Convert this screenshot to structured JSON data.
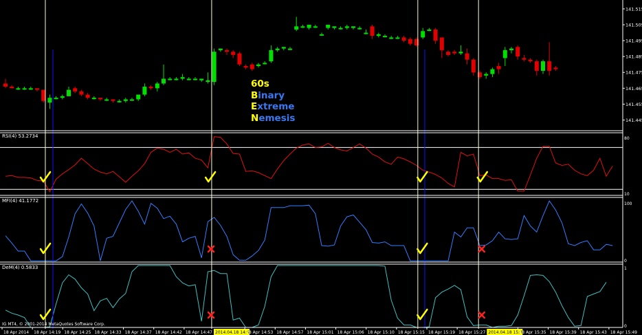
{
  "overlay": {
    "line1": "60s",
    "line2_first": "B",
    "line2_rest": "inary",
    "line3_first": "E",
    "line3_rest": "xtreme",
    "line4_first": "N",
    "line4_rest": "emesis"
  },
  "colors": {
    "background": "#000000",
    "up_candle": "#00e000",
    "down_candle": "#e00000",
    "rsi_line": "#e01010",
    "mfi_line": "#2f7fff",
    "dem_line": "#40c0c0",
    "separator": "#ffffff",
    "vline_marker": "#ffffcc",
    "vline_blue": "#1010ff",
    "check": "#ffff00",
    "cross": "#ff2020",
    "axis_text": "#ffffff",
    "highlight_label": "#ffff00"
  },
  "price_axis": {
    "labels": [
      "141.515",
      "141.505",
      "141.495",
      "141.485",
      "141.475",
      "141.465",
      "141.455",
      "141.445"
    ],
    "values": [
      141.515,
      141.505,
      141.495,
      141.485,
      141.475,
      141.465,
      141.455,
      141.445
    ]
  },
  "main_chart": {
    "type": "candlestick",
    "candles": [
      {
        "o": 141.468,
        "h": 141.471,
        "l": 141.465,
        "c": 141.466
      },
      {
        "o": 141.466,
        "h": 141.467,
        "l": 141.465,
        "c": 141.465
      },
      {
        "o": 141.465,
        "h": 141.466,
        "l": 141.464,
        "c": 141.465
      },
      {
        "o": 141.465,
        "h": 141.466,
        "l": 141.464,
        "c": 141.465
      },
      {
        "o": 141.465,
        "h": 141.466,
        "l": 141.464,
        "c": 141.465
      },
      {
        "o": 141.465,
        "h": 141.465,
        "l": 141.463,
        "c": 141.464
      },
      {
        "o": 141.464,
        "h": 141.464,
        "l": 141.456,
        "c": 141.457
      },
      {
        "o": 141.456,
        "h": 141.461,
        "l": 141.452,
        "c": 141.459
      },
      {
        "o": 141.459,
        "h": 141.46,
        "l": 141.458,
        "c": 141.459
      },
      {
        "o": 141.459,
        "h": 141.461,
        "l": 141.458,
        "c": 141.46
      },
      {
        "o": 141.46,
        "h": 141.466,
        "l": 141.46,
        "c": 141.464
      },
      {
        "o": 141.465,
        "h": 141.466,
        "l": 141.462,
        "c": 141.463
      },
      {
        "o": 141.463,
        "h": 141.464,
        "l": 141.46,
        "c": 141.461
      },
      {
        "o": 141.461,
        "h": 141.462,
        "l": 141.458,
        "c": 141.459
      },
      {
        "o": 141.459,
        "h": 141.46,
        "l": 141.458,
        "c": 141.459
      },
      {
        "o": 141.459,
        "h": 141.459,
        "l": 141.457,
        "c": 141.458
      },
      {
        "o": 141.458,
        "h": 141.459,
        "l": 141.457,
        "c": 141.458
      },
      {
        "o": 141.458,
        "h": 141.458,
        "l": 141.456,
        "c": 141.457
      },
      {
        "o": 141.457,
        "h": 141.458,
        "l": 141.456,
        "c": 141.457
      },
      {
        "o": 141.457,
        "h": 141.459,
        "l": 141.456,
        "c": 141.458
      },
      {
        "o": 141.458,
        "h": 141.459,
        "l": 141.457,
        "c": 141.458
      },
      {
        "o": 141.458,
        "h": 141.461,
        "l": 141.457,
        "c": 141.461
      },
      {
        "o": 141.461,
        "h": 141.468,
        "l": 141.46,
        "c": 141.466
      },
      {
        "o": 141.466,
        "h": 141.467,
        "l": 141.464,
        "c": 141.465
      },
      {
        "o": 141.465,
        "h": 141.469,
        "l": 141.463,
        "c": 141.468
      },
      {
        "o": 141.468,
        "h": 141.48,
        "l": 141.467,
        "c": 141.471
      },
      {
        "o": 141.471,
        "h": 141.472,
        "l": 141.47,
        "c": 141.471
      },
      {
        "o": 141.471,
        "h": 141.472,
        "l": 141.47,
        "c": 141.471
      },
      {
        "o": 141.471,
        "h": 141.474,
        "l": 141.47,
        "c": 141.472
      },
      {
        "o": 141.471,
        "h": 141.472,
        "l": 141.47,
        "c": 141.471
      },
      {
        "o": 141.471,
        "h": 141.472,
        "l": 141.47,
        "c": 141.471
      },
      {
        "o": 141.47,
        "h": 141.471,
        "l": 141.469,
        "c": 141.471
      },
      {
        "o": 141.469,
        "h": 141.475,
        "l": 141.468,
        "c": 141.47
      },
      {
        "o": 141.469,
        "h": 141.49,
        "l": 141.467,
        "c": 141.488
      },
      {
        "o": 141.489,
        "h": 141.49,
        "l": 141.488,
        "c": 141.49
      },
      {
        "o": 141.489,
        "h": 141.49,
        "l": 141.486,
        "c": 141.488
      },
      {
        "o": 141.488,
        "h": 141.489,
        "l": 141.484,
        "c": 141.486
      },
      {
        "o": 141.487,
        "h": 141.488,
        "l": 141.479,
        "c": 141.48
      },
      {
        "o": 141.479,
        "h": 141.48,
        "l": 141.477,
        "c": 141.478
      },
      {
        "o": 141.48,
        "h": 141.481,
        "l": 141.476,
        "c": 141.477
      },
      {
        "o": 141.479,
        "h": 141.481,
        "l": 141.478,
        "c": 141.48
      },
      {
        "o": 141.481,
        "h": 141.482,
        "l": 141.48,
        "c": 141.481
      },
      {
        "o": 141.482,
        "h": 141.492,
        "l": 141.481,
        "c": 141.489
      },
      {
        "o": 141.489,
        "h": 141.491,
        "l": 141.488,
        "c": 141.49
      },
      {
        "o": 141.49,
        "h": 141.491,
        "l": 141.489,
        "c": 141.491
      },
      {
        "o": 141.49,
        "h": 141.491,
        "l": 141.489,
        "c": 141.49
      },
      {
        "o": 141.502,
        "h": 141.51,
        "l": 141.501,
        "c": 141.504
      },
      {
        "o": 141.504,
        "h": 141.505,
        "l": 141.503,
        "c": 141.504
      },
      {
        "o": 141.503,
        "h": 141.505,
        "l": 141.502,
        "c": 141.505
      },
      {
        "o": 141.504,
        "h": 141.505,
        "l": 141.503,
        "c": 141.504
      },
      {
        "o": 141.499,
        "h": 141.5,
        "l": 141.498,
        "c": 141.499
      },
      {
        "o": 141.503,
        "h": 141.505,
        "l": 141.502,
        "c": 141.505
      },
      {
        "o": 141.503,
        "h": 141.504,
        "l": 141.502,
        "c": 141.504
      },
      {
        "o": 141.503,
        "h": 141.504,
        "l": 141.502,
        "c": 141.503
      },
      {
        "o": 141.503,
        "h": 141.505,
        "l": 141.502,
        "c": 141.504
      },
      {
        "o": 141.503,
        "h": 141.504,
        "l": 141.502,
        "c": 141.504
      },
      {
        "o": 141.503,
        "h": 141.504,
        "l": 141.502,
        "c": 141.503
      },
      {
        "o": 141.5,
        "h": 141.502,
        "l": 141.499,
        "c": 141.5
      },
      {
        "o": 141.504,
        "h": 141.505,
        "l": 141.496,
        "c": 141.498
      },
      {
        "o": 141.498,
        "h": 141.5,
        "l": 141.497,
        "c": 141.499
      },
      {
        "o": 141.498,
        "h": 141.499,
        "l": 141.497,
        "c": 141.498
      },
      {
        "o": 141.497,
        "h": 141.498,
        "l": 141.496,
        "c": 141.497
      },
      {
        "o": 141.497,
        "h": 141.498,
        "l": 141.496,
        "c": 141.497
      },
      {
        "o": 141.497,
        "h": 141.498,
        "l": 141.494,
        "c": 141.495
      },
      {
        "o": 141.496,
        "h": 141.497,
        "l": 141.492,
        "c": 141.493
      },
      {
        "o": 141.496,
        "h": 141.497,
        "l": 141.491,
        "c": 141.492
      },
      {
        "o": 141.497,
        "h": 141.503,
        "l": 141.496,
        "c": 141.501
      },
      {
        "o": 141.502,
        "h": 141.503,
        "l": 141.501,
        "c": 141.502
      },
      {
        "o": 141.502,
        "h": 141.503,
        "l": 141.493,
        "c": 141.495
      },
      {
        "o": 141.497,
        "h": 141.497,
        "l": 141.484,
        "c": 141.489
      },
      {
        "o": 141.488,
        "h": 141.489,
        "l": 141.485,
        "c": 141.486
      },
      {
        "o": 141.488,
        "h": 141.489,
        "l": 141.486,
        "c": 141.487
      },
      {
        "o": 141.487,
        "h": 141.492,
        "l": 141.486,
        "c": 141.488
      },
      {
        "o": 141.487,
        "h": 141.49,
        "l": 141.48,
        "c": 141.483
      },
      {
        "o": 141.483,
        "h": 141.484,
        "l": 141.473,
        "c": 141.475
      },
      {
        "o": 141.475,
        "h": 141.476,
        "l": 141.471,
        "c": 141.472
      },
      {
        "o": 141.473,
        "h": 141.475,
        "l": 141.471,
        "c": 141.474
      },
      {
        "o": 141.474,
        "h": 141.478,
        "l": 141.472,
        "c": 141.477
      },
      {
        "o": 141.479,
        "h": 141.481,
        "l": 141.474,
        "c": 141.477
      },
      {
        "o": 141.484,
        "h": 141.491,
        "l": 141.479,
        "c": 141.489
      },
      {
        "o": 141.489,
        "h": 141.491,
        "l": 141.487,
        "c": 141.49
      },
      {
        "o": 141.491,
        "h": 141.492,
        "l": 141.483,
        "c": 141.485
      },
      {
        "o": 141.484,
        "h": 141.486,
        "l": 141.482,
        "c": 141.483
      },
      {
        "o": 141.483,
        "h": 141.484,
        "l": 141.481,
        "c": 141.482
      },
      {
        "o": 141.482,
        "h": 141.483,
        "l": 141.473,
        "c": 141.476
      },
      {
        "o": 141.476,
        "h": 141.483,
        "l": 141.474,
        "c": 141.482
      },
      {
        "o": 141.482,
        "h": 141.494,
        "l": 141.473,
        "c": 141.476
      },
      {
        "o": 141.478,
        "h": 141.479,
        "l": 141.476,
        "c": 141.477
      }
    ]
  },
  "vertical_markers": [
    {
      "candle_index": 6.3,
      "style": "light"
    },
    {
      "candle_index": 7.5,
      "style": "blue"
    },
    {
      "candle_index": 32.6,
      "style": "light"
    },
    {
      "candle_index": 65.2,
      "style": "light"
    },
    {
      "candle_index": 66.3,
      "style": "blue"
    },
    {
      "candle_index": 74.8,
      "style": "light"
    }
  ],
  "rsi": {
    "label": "RSI(4) 53.2734",
    "scale_top": "80",
    "scale_bottom": "10",
    "values": [
      32,
      33,
      30,
      30,
      29,
      25,
      24,
      6,
      27,
      36,
      43,
      51,
      62,
      53,
      44,
      39,
      36,
      40,
      31,
      22,
      32,
      41,
      53,
      72,
      79,
      77,
      72,
      77,
      69,
      71,
      62,
      59,
      46,
      98,
      97,
      86,
      70,
      69,
      40,
      41,
      38,
      33,
      28,
      44,
      58,
      69,
      79,
      84,
      86,
      80,
      81,
      87,
      80,
      76,
      74,
      80,
      86,
      79,
      69,
      64,
      56,
      52,
      64,
      61,
      56,
      50,
      42,
      39,
      35,
      29,
      20,
      14,
      72,
      66,
      69,
      33,
      34,
      28,
      28,
      25,
      26,
      7,
      7,
      34,
      62,
      82,
      82,
      54,
      50,
      52,
      42,
      36,
      33,
      42,
      62,
      32,
      49
    ]
  },
  "mfi": {
    "label": "MFI(4) 41.1772",
    "scale_top": "100",
    "scale_bottom": "0",
    "values": [
      43,
      31,
      18,
      18,
      2,
      2,
      2,
      2,
      2,
      9,
      41,
      79,
      95,
      80,
      59,
      2,
      39,
      42,
      64,
      86,
      100,
      83,
      62,
      96,
      88,
      71,
      75,
      62,
      33,
      39,
      42,
      7,
      66,
      73,
      60,
      42,
      12,
      3,
      3,
      10,
      19,
      36,
      89,
      89,
      89,
      92,
      92,
      92,
      93,
      79,
      27,
      26,
      28,
      59,
      74,
      77,
      65,
      53,
      32,
      31,
      33,
      27,
      27,
      27,
      2,
      2,
      2,
      2,
      2,
      2,
      2,
      49,
      41,
      56,
      56,
      27,
      28,
      35,
      49,
      38,
      37,
      38,
      76,
      59,
      49,
      76,
      100,
      85,
      64,
      30,
      27,
      32,
      35,
      20,
      20,
      29,
      27
    ]
  },
  "dem": {
    "label": "DeM(4) 0.5833",
    "scale_top": "1",
    "scale_bottom": "0",
    "values": [
      0.28,
      0.23,
      0.2,
      0.16,
      0.0,
      0.0,
      0.0,
      0.01,
      0.38,
      0.72,
      0.85,
      0.78,
      0.64,
      0.54,
      0.27,
      0.43,
      0.47,
      0.32,
      0.46,
      0.55,
      0.9,
      1.0,
      1.0,
      1.0,
      1.0,
      1.0,
      1.0,
      0.82,
      0.72,
      0.67,
      0.69,
      0.1,
      0.9,
      0.92,
      0.87,
      0.87,
      0.12,
      0.15,
      0.0,
      0.0,
      0.04,
      0.34,
      0.82,
      1.0,
      1.0,
      1.0,
      1.0,
      1.0,
      1.0,
      1.0,
      1.0,
      1.0,
      1.0,
      1.0,
      1.0,
      1.0,
      1.0,
      1.0,
      1.0,
      1.0,
      0.99,
      0.44,
      0.15,
      0.04,
      0.04,
      0.0,
      0.0,
      0.01,
      0.48,
      0.57,
      0.62,
      0.68,
      0.61,
      0.17,
      0.03,
      0.04,
      0.04,
      0.0,
      0.02,
      0.02,
      0.03,
      0.2,
      0.51,
      0.84,
      0.85,
      0.84,
      0.74,
      0.57,
      0.35,
      0.16,
      0.02,
      0.03,
      0.5,
      0.54,
      0.58,
      0.73
    ]
  },
  "signals": [
    {
      "panel": "rsi",
      "candle_index": 6.2,
      "type": "check"
    },
    {
      "panel": "mfi",
      "candle_index": 6.2,
      "type": "check"
    },
    {
      "panel": "dem",
      "candle_index": 6.2,
      "type": "check"
    },
    {
      "panel": "rsi",
      "candle_index": 32.3,
      "type": "check"
    },
    {
      "panel": "mfi",
      "candle_index": 32.5,
      "type": "cross"
    },
    {
      "panel": "dem",
      "candle_index": 32.5,
      "type": "cross"
    },
    {
      "panel": "rsi",
      "candle_index": 65.8,
      "type": "check"
    },
    {
      "panel": "mfi",
      "candle_index": 65.8,
      "type": "check"
    },
    {
      "panel": "dem",
      "candle_index": 65.8,
      "type": "check"
    },
    {
      "panel": "rsi",
      "candle_index": 75.3,
      "type": "check"
    },
    {
      "panel": "mfi",
      "candle_index": 75.3,
      "type": "cross"
    },
    {
      "panel": "dem",
      "candle_index": 75.3,
      "type": "cross"
    }
  ],
  "copyright": "IG MT4, © 2001-2014 MetaQuotes Software Corp.",
  "time_axis": [
    {
      "label": "18 Apr 2014",
      "highlight": false
    },
    {
      "label": "18 Apr 14:19",
      "highlight": false
    },
    {
      "label": "18 Apr 14:25",
      "highlight": false
    },
    {
      "label": "18 Apr 14:33",
      "highlight": false
    },
    {
      "label": "18 Apr 14:37",
      "highlight": false
    },
    {
      "label": "18 Apr 14:42",
      "highlight": false
    },
    {
      "label": "18 Apr 14:47",
      "highlight": false
    },
    {
      "label": "2014.04.18 14:52",
      "highlight": true
    },
    {
      "label": "18 Apr 14:53",
      "highlight": false
    },
    {
      "label": "18 Apr 14:57",
      "highlight": false
    },
    {
      "label": "18 Apr 15:01",
      "highlight": false
    },
    {
      "label": "18 Apr 15:06",
      "highlight": false
    },
    {
      "label": "18 Apr 15:10",
      "highlight": false
    },
    {
      "label": "18 Apr 15:15",
      "highlight": false
    },
    {
      "label": "18 Apr 15:19",
      "highlight": false
    },
    {
      "label": "18 Apr 15:27",
      "highlight": false
    },
    {
      "label": "2014.04.18 15:35",
      "highlight": true
    },
    {
      "label": "18 Apr 15:35",
      "highlight": false
    },
    {
      "label": "18 Apr 15:39",
      "highlight": false
    },
    {
      "label": "18 Apr 15:43",
      "highlight": false
    },
    {
      "label": "18 Apr 15:49",
      "highlight": false
    }
  ]
}
